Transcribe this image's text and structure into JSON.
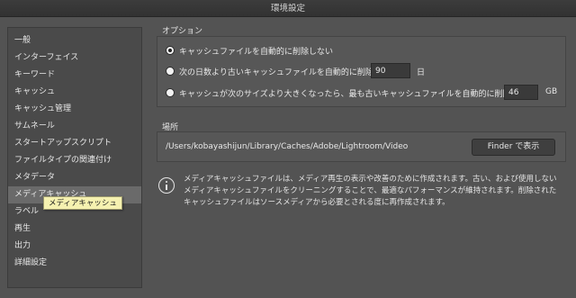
{
  "window": {
    "title": "環境設定"
  },
  "sidebar": {
    "items": [
      {
        "label": "一般"
      },
      {
        "label": "インターフェイス"
      },
      {
        "label": "キーワード"
      },
      {
        "label": "キャッシュ"
      },
      {
        "label": "キャッシュ管理"
      },
      {
        "label": "サムネール"
      },
      {
        "label": "スタートアップスクリプト"
      },
      {
        "label": "ファイルタイプの関連付け"
      },
      {
        "label": "メタデータ"
      },
      {
        "label": "メディアキャッシュ",
        "selected": true
      },
      {
        "label": "ラベル"
      },
      {
        "label": "再生"
      },
      {
        "label": "出力"
      },
      {
        "label": "詳細設定"
      }
    ],
    "tooltip": "メディアキャッシュ"
  },
  "options": {
    "title": "オプション",
    "radios": [
      {
        "label": "キャッシュファイルを自動的に削除しない",
        "checked": true
      },
      {
        "label": "次の日数より古いキャッシュファイルを自動的に削除",
        "value": "90",
        "unit": "日"
      },
      {
        "label": "キャッシュが次のサイズより大きくなったら、最も古いキャッシュファイルを自動的に削除",
        "value": "46",
        "unit": "GB"
      }
    ]
  },
  "location": {
    "title": "場所",
    "path": "/Users/kobayashijun/Library/Caches/Adobe/Lightroom/Video",
    "finder_button": "Finder で表示"
  },
  "info": {
    "icon": "info-icon",
    "text": "メディアキャッシュファイルは、メディア再生の表示や改善のために作成されます。古い、および使用しないメディアキャッシュファイルをクリーニングすることで、最適なパフォーマンスが維持されます。削除されたキャッシュファイルはソースメディアから必要とされる度に再作成されます。"
  }
}
